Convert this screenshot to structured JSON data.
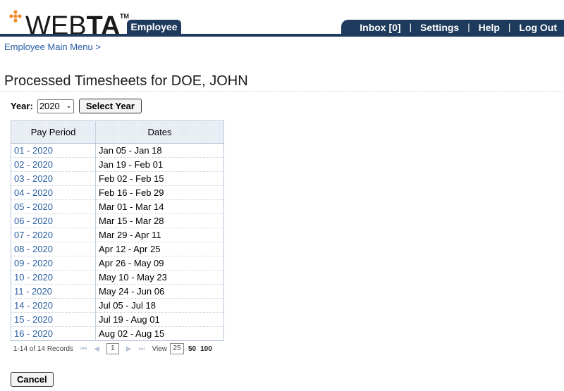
{
  "header": {
    "logo_web": "WEB",
    "logo_ta": "TA",
    "logo_tm": "TM",
    "employee_tab": "Employee",
    "nav": {
      "inbox": "Inbox [0]",
      "settings": "Settings",
      "help": "Help",
      "logout": "Log Out",
      "separator": "|"
    },
    "brand_color": "#1e3a5c",
    "logo_dot_color": "#f08a24"
  },
  "breadcrumb": "Employee Main Menu >",
  "page_title": "Processed Timesheets for DOE, JOHN",
  "year": {
    "label": "Year:",
    "selected": "2020",
    "button": "Select Year"
  },
  "table": {
    "columns": [
      "Pay Period",
      "Dates"
    ],
    "rows": [
      {
        "period": "01 - 2020",
        "dates": "Jan 05 - Jan 18"
      },
      {
        "period": "02 - 2020",
        "dates": "Jan 19 - Feb 01"
      },
      {
        "period": "03 - 2020",
        "dates": "Feb 02 - Feb 15"
      },
      {
        "period": "04 - 2020",
        "dates": "Feb 16 - Feb 29"
      },
      {
        "period": "05 - 2020",
        "dates": "Mar 01 - Mar 14"
      },
      {
        "period": "06 - 2020",
        "dates": "Mar 15 - Mar 28"
      },
      {
        "period": "07 - 2020",
        "dates": "Mar 29 - Apr 11"
      },
      {
        "period": "08 - 2020",
        "dates": "Apr 12 - Apr 25"
      },
      {
        "period": "09 - 2020",
        "dates": "Apr 26 - May 09"
      },
      {
        "period": "10 - 2020",
        "dates": "May 10 - May 23"
      },
      {
        "period": "11 - 2020",
        "dates": "May 24 - Jun 06"
      },
      {
        "period": "14 - 2020",
        "dates": "Jul 05 - Jul 18"
      },
      {
        "period": "15 - 2020",
        "dates": "Jul 19 - Aug 01"
      },
      {
        "period": "16 - 2020",
        "dates": "Aug 02 - Aug 15"
      }
    ]
  },
  "pager": {
    "records": "1-14 of 14 Records",
    "current_page": "1",
    "view_label": "View",
    "view_options": [
      "25",
      "50",
      "100"
    ],
    "icons": [
      "first-page-icon",
      "prev-page-icon",
      "next-page-icon",
      "last-page-icon"
    ]
  },
  "cancel_button": "Cancel"
}
